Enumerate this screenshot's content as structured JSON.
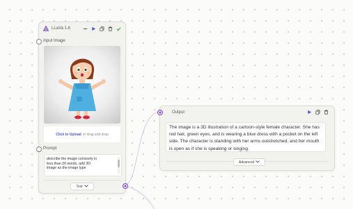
{
  "llava_node": {
    "title": "LLaVa 1.6",
    "input_image_label": "Input Image",
    "upload_link": "Click to Upload",
    "upload_rest": "or drag and drop",
    "prompt_label": "Prompt",
    "prompt_text": "describe the image concisely  in\nless than 20 words, add 3D\nimage as the image type",
    "output_type": "Text"
  },
  "output_node": {
    "title": "Output",
    "text": "The image is a 3D illustration of a cartoon-style female character. She has red hair, green eyes, and is wearing a blue dress with a pocket on the left side. The character is standing with her arms outstretched, and her mouth is open as if she is speaking or singing.",
    "advanced_label": "Advanced"
  },
  "colors": {
    "accent": "#7a3fc9",
    "link": "#4a58c8",
    "run_icon": "#4a58c8",
    "check_icon": "#3aa64a"
  },
  "icons": [
    "llava-logo-icon",
    "minimize-icon",
    "run-icon",
    "copy-icon",
    "delete-icon",
    "check-icon",
    "chevron-down-icon"
  ]
}
